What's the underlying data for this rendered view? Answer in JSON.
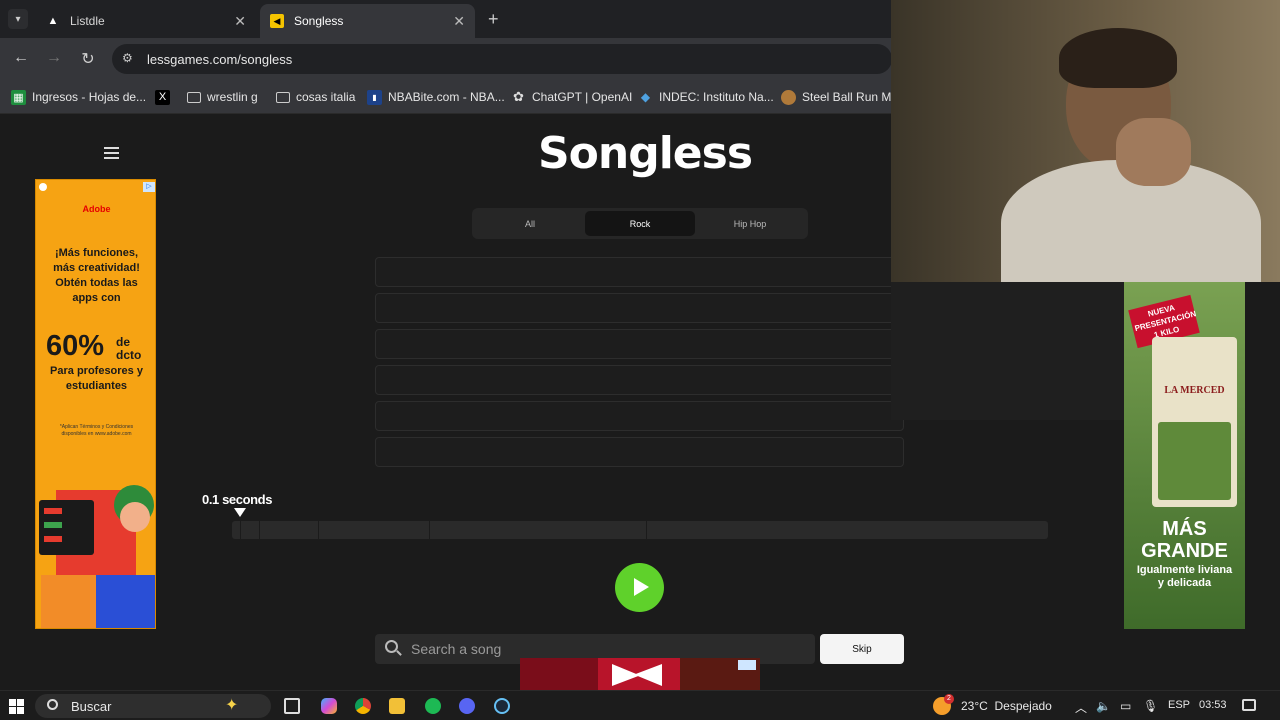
{
  "browser": {
    "tabs": [
      {
        "title": "Listdle",
        "active": false
      },
      {
        "title": "Songless",
        "active": true
      }
    ],
    "url": "lessgames.com/songless",
    "bookmarks": [
      {
        "label": "Ingresos - Hojas de...",
        "icon": "sheets-icon",
        "color": "#1e8e3e"
      },
      {
        "label": "",
        "icon": "x-icon",
        "color": "#000000"
      },
      {
        "label": "wrestlin g",
        "icon": "folder-icon",
        "color": "#cccccc"
      },
      {
        "label": "cosas italia",
        "icon": "folder-icon",
        "color": "#cccccc"
      },
      {
        "label": "NBABite.com - NBA...",
        "icon": "nba-icon",
        "color": "#c9082a"
      },
      {
        "label": "ChatGPT | OpenAI",
        "icon": "openai-icon",
        "color": "#dddddd"
      },
      {
        "label": "INDEC: Instituto Na...",
        "icon": "indec-icon",
        "color": "#4ea1e0"
      },
      {
        "label": "Steel Ball Run Mar",
        "icon": "steel-ball-icon",
        "color": "#b07a3a"
      }
    ]
  },
  "page": {
    "logo": "Songless",
    "genres": [
      {
        "label": "All",
        "active": false
      },
      {
        "label": "Rock",
        "active": true
      },
      {
        "label": "Hip Hop",
        "active": false
      }
    ],
    "guess_count": 6,
    "seconds_label": "0.1 seconds",
    "search_placeholder": "Search a song",
    "skip_label": "Skip"
  },
  "ads": {
    "left": {
      "brand": "Adobe",
      "headline": "¡Más funciones, más creatividad! Obtén todas las apps con",
      "discount_big": "60%",
      "discount_small": "de dcto",
      "audience": "Para profesores y estudiantes",
      "fineprint": "*Aplican Términos y Condiciones disponibles en www.adobe.com"
    },
    "right": {
      "badge": "NUEVA PRESENTACIÓN 1 KILO",
      "brand": "LA MERCED",
      "headline": "MÁS GRANDE",
      "sub": "Igualmente liviana y delicada"
    }
  },
  "taskbar": {
    "search_label": "Buscar",
    "weather": "23°C  Despejado",
    "weather_badge": "2",
    "lang": "ESP",
    "time": "03:53"
  }
}
